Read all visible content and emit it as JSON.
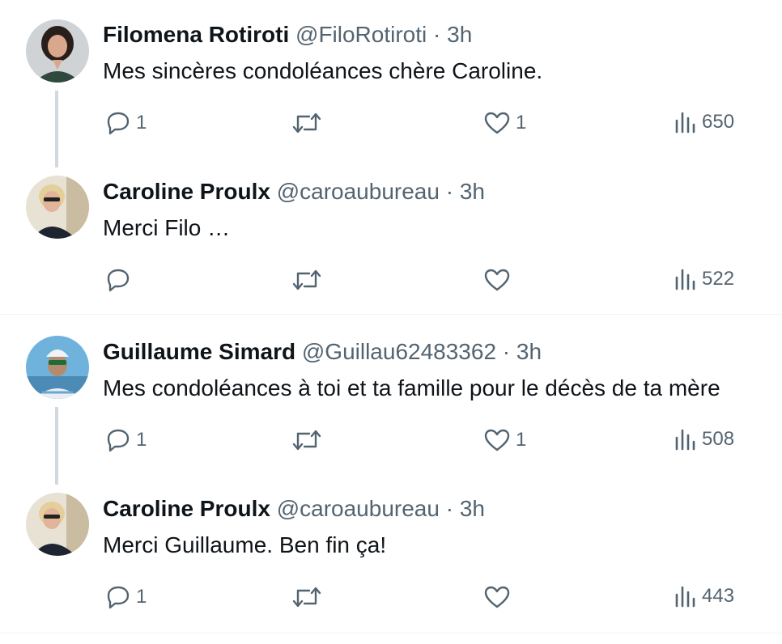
{
  "tweets": [
    {
      "name": "Filomena Rotiroti",
      "handle": "@FiloRotiroti",
      "time": "3h",
      "text": "Mes sincères condoléances chère Caroline.",
      "replies": "1",
      "retweets": "",
      "likes": "1",
      "views": "650"
    },
    {
      "name": "Caroline Proulx",
      "handle": "@caroaubureau",
      "time": "3h",
      "text": "Merci Filo …",
      "replies": "",
      "retweets": "",
      "likes": "",
      "views": "522"
    },
    {
      "name": "Guillaume Simard",
      "handle": "@Guillau62483362",
      "time": "3h",
      "text": "Mes condoléances à toi et ta famille pour le décès de ta mère",
      "replies": "1",
      "retweets": "",
      "likes": "1",
      "views": "508"
    },
    {
      "name": "Caroline Proulx",
      "handle": "@caroaubureau",
      "time": "3h",
      "text": "Merci Guillaume. Ben fin ça!",
      "replies": "1",
      "retweets": "",
      "likes": "",
      "views": "443"
    }
  ],
  "separator": " · ",
  "icons": {
    "reply": "reply-icon",
    "retweet": "retweet-icon",
    "like": "heart-icon",
    "views": "views-icon"
  },
  "colors": {
    "text": "#0f1419",
    "secondary": "#536471",
    "thread_line": "#cfd9de",
    "divider": "#eff3f4"
  }
}
